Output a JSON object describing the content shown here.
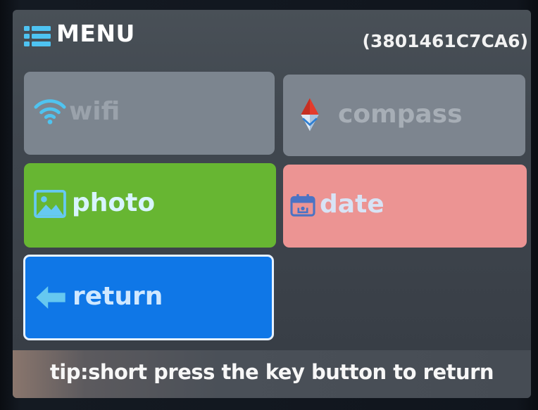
{
  "header": {
    "title": "MENU",
    "device_id": "(3801461C7CA6)",
    "icon": "list-menu-icon"
  },
  "tiles": [
    {
      "label": "wifi",
      "icon": "wifi-icon",
      "color": "#7c858f",
      "state": "disabled"
    },
    {
      "label": "compass",
      "icon": "compass-icon",
      "color": "#7d858f",
      "state": "disabled"
    },
    {
      "label": "photo",
      "icon": "image-icon",
      "color": "#67b632",
      "state": "enabled"
    },
    {
      "label": "date",
      "icon": "calendar-icon",
      "color": "#ec9493",
      "state": "enabled"
    },
    {
      "label": "return",
      "icon": "arrow-left-icon",
      "color": "#0f77e7",
      "state": "selected"
    }
  ],
  "tip": "tip:short press the key button to return"
}
